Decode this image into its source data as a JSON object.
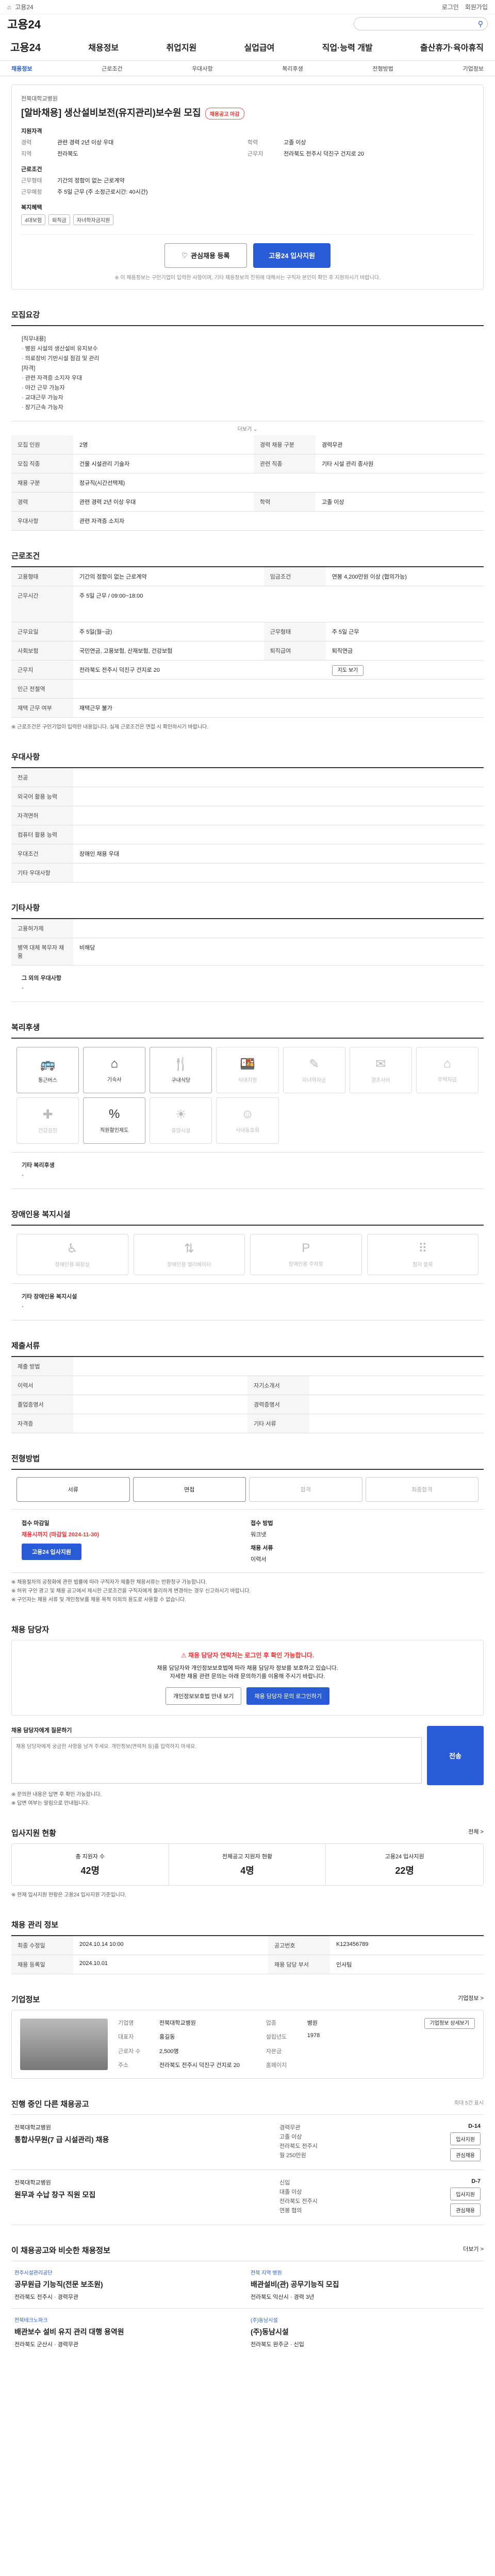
{
  "topbar": {
    "label": "고용24",
    "links": [
      "로그인",
      "회원가입"
    ]
  },
  "logo_text": "고용24",
  "gnb": {
    "brand": "고용24",
    "items": [
      "채용정보",
      "취업지원",
      "실업급여",
      "직업·능력 개발",
      "출산휴가·육아휴직"
    ]
  },
  "subnav": [
    "채용정보",
    "근로조건",
    "우대사항",
    "복리후생",
    "전형방법",
    "기업정보"
  ],
  "header": {
    "company": "전북대학교병원 ",
    "title": "[알바채용] 생산설비보전(유지관리)보수원 모집",
    "badge": "채용공고 마감",
    "info_label": "지원자격",
    "rows": [
      [
        "경력",
        "관련 경력 2년 이상 우대",
        "학력",
        "고졸 이상"
      ],
      [
        "지역",
        "전라북도",
        "근무지",
        "전라북도 전주시 덕진구 건지로 20"
      ]
    ],
    "cond_label": "근로조건",
    "cond_rows": [
      [
        "근무형태",
        "기간의 정함이 없는 근로계약"
      ],
      [
        "근무예정",
        "주 5일 근무 (주 소정근로시간: 40시간)"
      ]
    ],
    "tags_label": "복지혜택",
    "tags": [
      "4대보험",
      "퇴직금",
      "자녀학자금지원"
    ],
    "scrap": "관심채용 등록",
    "apply": "고용24 입사지원",
    "note": "※ 이 채용정보는 구인기업이 입력한 사항이며, 기타 채용정보의 진위에 대해서는 구직자 본인이 확인 후 지원하시기 바랍니다."
  },
  "recruit": {
    "title": "모집요강",
    "duty_text": "[직무내용]\n· 병원 시설의 생산설비 유지보수\n· 의료장비 기반시설 점검 및 관리\n[자격]\n· 관련 자격증 소지자 우대\n· 야간 근무 가능자\n· 교대근무 가능자\n· 장기근속 가능자",
    "more": "더보기",
    "rows": [
      [
        "모집 인원",
        "2명",
        "경력 채용 구분",
        "경력무관"
      ],
      [
        "모집 직종",
        "건물 시설관리 기술자",
        "관련 직종",
        "기타 시설 관리 종사원"
      ],
      [
        "채용 구분",
        "정규직(시간선택제)",
        "",
        " "
      ],
      [
        "경력",
        "관련 경력 2년 이상 우대",
        "학력",
        "고졸 이상"
      ],
      [
        "우대사항",
        "관련 자격증 소지자",
        "",
        ""
      ]
    ]
  },
  "work": {
    "title": "근로조건",
    "rows": [
      [
        "고용형태",
        "기간의 정함이 없는 근로계약",
        "임금조건",
        "연봉 4,200만원 이상 (협의가능)"
      ],
      [
        "근무시간",
        "주 5일 근무 / 09:00~18:00",
        "",
        ""
      ],
      [
        "근무요일",
        "주 5일(월~금)",
        "근무형태",
        "주 5일 근무"
      ],
      [
        "사회보험",
        "국민연금, 고용보험, 산재보험, 건강보험",
        "퇴직급여",
        "퇴직연금"
      ],
      [
        "근무지",
        "전라북도 전주시 덕진구 건지로 20",
        "",
        ""
      ],
      [
        "인근 전철역",
        "",
        "",
        ""
      ],
      [
        "재택 근무 여부",
        "재택근무 불가",
        "",
        ""
      ]
    ],
    "map": "지도 보기",
    "wage_note": "※ 근로조건은 구인기업이 입력한 내용입니다. 실제 근로조건은 면접 시 확인하시기 바랍니다."
  },
  "prefer": {
    "title": "우대사항",
    "rows": [
      [
        "전공",
        ""
      ],
      [
        "외국어 활용 능력",
        ""
      ],
      [
        "자격면허",
        ""
      ],
      [
        "컴퓨터 활용 능력",
        ""
      ],
      [
        "우대조건",
        "장애인 채용 우대"
      ],
      [
        "기타 우대사항",
        ""
      ]
    ]
  },
  "etc": {
    "title": "기타사항",
    "rows": [
      [
        "고용허가제",
        ""
      ],
      [
        "병역 대체 복무자 채용",
        "비해당"
      ]
    ],
    "extra_label": "그 외의 우대사항",
    "extra_val": "-"
  },
  "welfare": {
    "title": "복리후생",
    "items": [
      {
        "name": "통근버스",
        "icon": "bus-icon",
        "on": true
      },
      {
        "name": "기숙사",
        "icon": "home-icon",
        "on": true
      },
      {
        "name": "구내식당",
        "icon": "meal-icon",
        "on": true
      },
      {
        "name": "식대지원",
        "icon": "food-icon",
        "on": false
      },
      {
        "name": "자녀학자금",
        "icon": "education-icon",
        "on": false
      },
      {
        "name": "경조사비",
        "icon": "gift-icon",
        "on": false
      },
      {
        "name": "주택자금",
        "icon": "house-icon",
        "on": false
      },
      {
        "name": "건강검진",
        "icon": "health-icon",
        "on": false
      },
      {
        "name": "직원할인제도",
        "icon": "discount-icon",
        "on": true
      },
      {
        "name": "휴양시설",
        "icon": "vacation-icon",
        "on": false
      },
      {
        "name": "사내동호회",
        "icon": "club-icon",
        "on": false
      }
    ],
    "extra_label": "기타 복리후생",
    "extra_val": "-"
  },
  "disabled": {
    "title": "장애인용 복지시설",
    "items": [
      "장애인용 화장실",
      "장애인용 엘리베이터",
      "장애인용 주차장",
      "점자 블록"
    ],
    "extra_label": "기타 장애인용 복지시설",
    "extra_val": "-"
  },
  "docs": {
    "title": "제출서류",
    "rows": [
      [
        "제출 방법",
        "",
        "",
        ""
      ],
      [
        "이력서",
        "",
        "자기소개서",
        ""
      ],
      [
        "졸업증명서",
        "",
        "경력증명서",
        ""
      ],
      [
        "자격증",
        "",
        "기타 서류",
        ""
      ]
    ]
  },
  "process": {
    "title": "전형방법",
    "steps": [
      "서류",
      "면접",
      "합격",
      "최종합격"
    ],
    "on": [
      true,
      true,
      false,
      false
    ]
  },
  "apply": {
    "period_k": "접수 마감일",
    "period_v": "채용시까지 (마감일 2024-11-30)",
    "method_k": "접수 방법",
    "method_v": "워크넷",
    "btn": "고용24 입사지원",
    "doc_k": "채용 서류",
    "doc_v": "이력서",
    "bullets": [
      "※ 채용절차의 공정화에 관한 법률에 따라 구직자가 제출한 채용서류는 반환청구 가능합니다.",
      "※ 허위 구인 광고 및 채용 공고에서 제시한 근로조건을 구직자에게 불리하게 변경하는 경우 신고하시기 바랍니다.",
      "※ 구인자는 채용 서류 및 개인정보를 채용 목적 이외의 용도로 사용할 수 없습니다."
    ]
  },
  "contact": {
    "title": "채용 담당자",
    "warn": "채용 담당자 연락처는 로그인 후 확인 가능합니다.",
    "desc1": "채용 담당자와 개인정보보호법에 따라 채용 담당자 정보를 보호하고 있습니다.",
    "desc2": "자세한 채용 관련 문의는 아래 문의하기를 이용해 주시기 바랍니다.",
    "btn1": "개인정보보호법 안내 보기",
    "btn2": "채용 담당자 문의 로그인하기",
    "q_label": "채용 담당자에게 질문하기",
    "q_placeholder": "채용 담당자에게 궁금한 사항을 남겨 주세요. 개인정보(연락처 등)를 입력하지 마세요.",
    "send": "전송",
    "bullets": [
      "※ 문의한 내용은 답변 후 확인 가능합니다.",
      "※ 답변 여부는 알림으로 안내됩니다."
    ]
  },
  "stats": {
    "title": "입사지원 현황",
    "all": "전체 >",
    "cells": [
      [
        "총 지원자 수",
        "42명"
      ],
      [
        "전체공고 지원자 현황",
        "4명"
      ],
      [
        "고용24 입사지원",
        "22명"
      ]
    ],
    "note": "※ 현재 입사지원 현황은 고용24 입사지원 기준입니다."
  },
  "manage": {
    "title": "채용 관리 정보",
    "rows": [
      [
        "최종 수정일",
        "2024.10.14 10:00",
        "공고번호",
        "K123456789"
      ],
      [
        "채용 등록일",
        "2024.10.01",
        "채용 담당 부서",
        "인사팀"
      ]
    ]
  },
  "corp": {
    "title": "기업정보",
    "all": "기업정보 >",
    "rows": [
      [
        "기업명",
        "전북대학교병원",
        "업종",
        "병원"
      ],
      [
        "대표자",
        "홍길동",
        "설립년도",
        "1978"
      ],
      [
        "근로자 수",
        "2,500명",
        "자본금",
        ""
      ],
      [
        "주소",
        "전라북도 전주시 덕진구 건지로 20",
        "홈페이지",
        ""
      ]
    ],
    "btn": "기업정보 상세보기"
  },
  "jobs": {
    "title": "진행 중인 다른 채용공고",
    "more": "최대 5건 표시",
    "items": [
      {
        "company": "전북대학교병원",
        "title": "통합사무원(7 급 시설관리) 채용",
        "meta": [
          "경력무관",
          "고졸 이상",
          "전라북도 전주시",
          "월 250만원"
        ],
        "d": "D-14",
        "btn1": "입사지원",
        "btn2": "관심채용"
      },
      {
        "company": "전북대학교병원",
        "title": "원무과 수납 창구 직원 모집",
        "meta": [
          "신입",
          "대졸 이상",
          "전라북도 전주시",
          "연봉 협의"
        ],
        "d": "D-7",
        "btn1": "입사지원",
        "btn2": "관심채용"
      }
    ]
  },
  "recommend": {
    "title": "이 채용공고와 비슷한 채용정보",
    "all": "더보기 >",
    "items": [
      {
        "company": "전주시설관리공단",
        "title": "공무원급 기능직(전문 보조원)",
        "meta": "전라북도 전주시 · 경력무관"
      },
      {
        "company": "전북 지역 병원",
        "title": "배관설비(관) 공무기능직 모집",
        "meta": "전라북도 익산시 · 경력 3년"
      },
      {
        "company": "전북테크노파크",
        "title": "배관보수 설비 유지 관리 대행 용역원",
        "meta": "전라북도 군산시 · 경력무관"
      },
      {
        "company": "(주)동남시설",
        "title": "(주)동남시설",
        "meta": "전라북도 완주군 · 신입"
      }
    ]
  }
}
